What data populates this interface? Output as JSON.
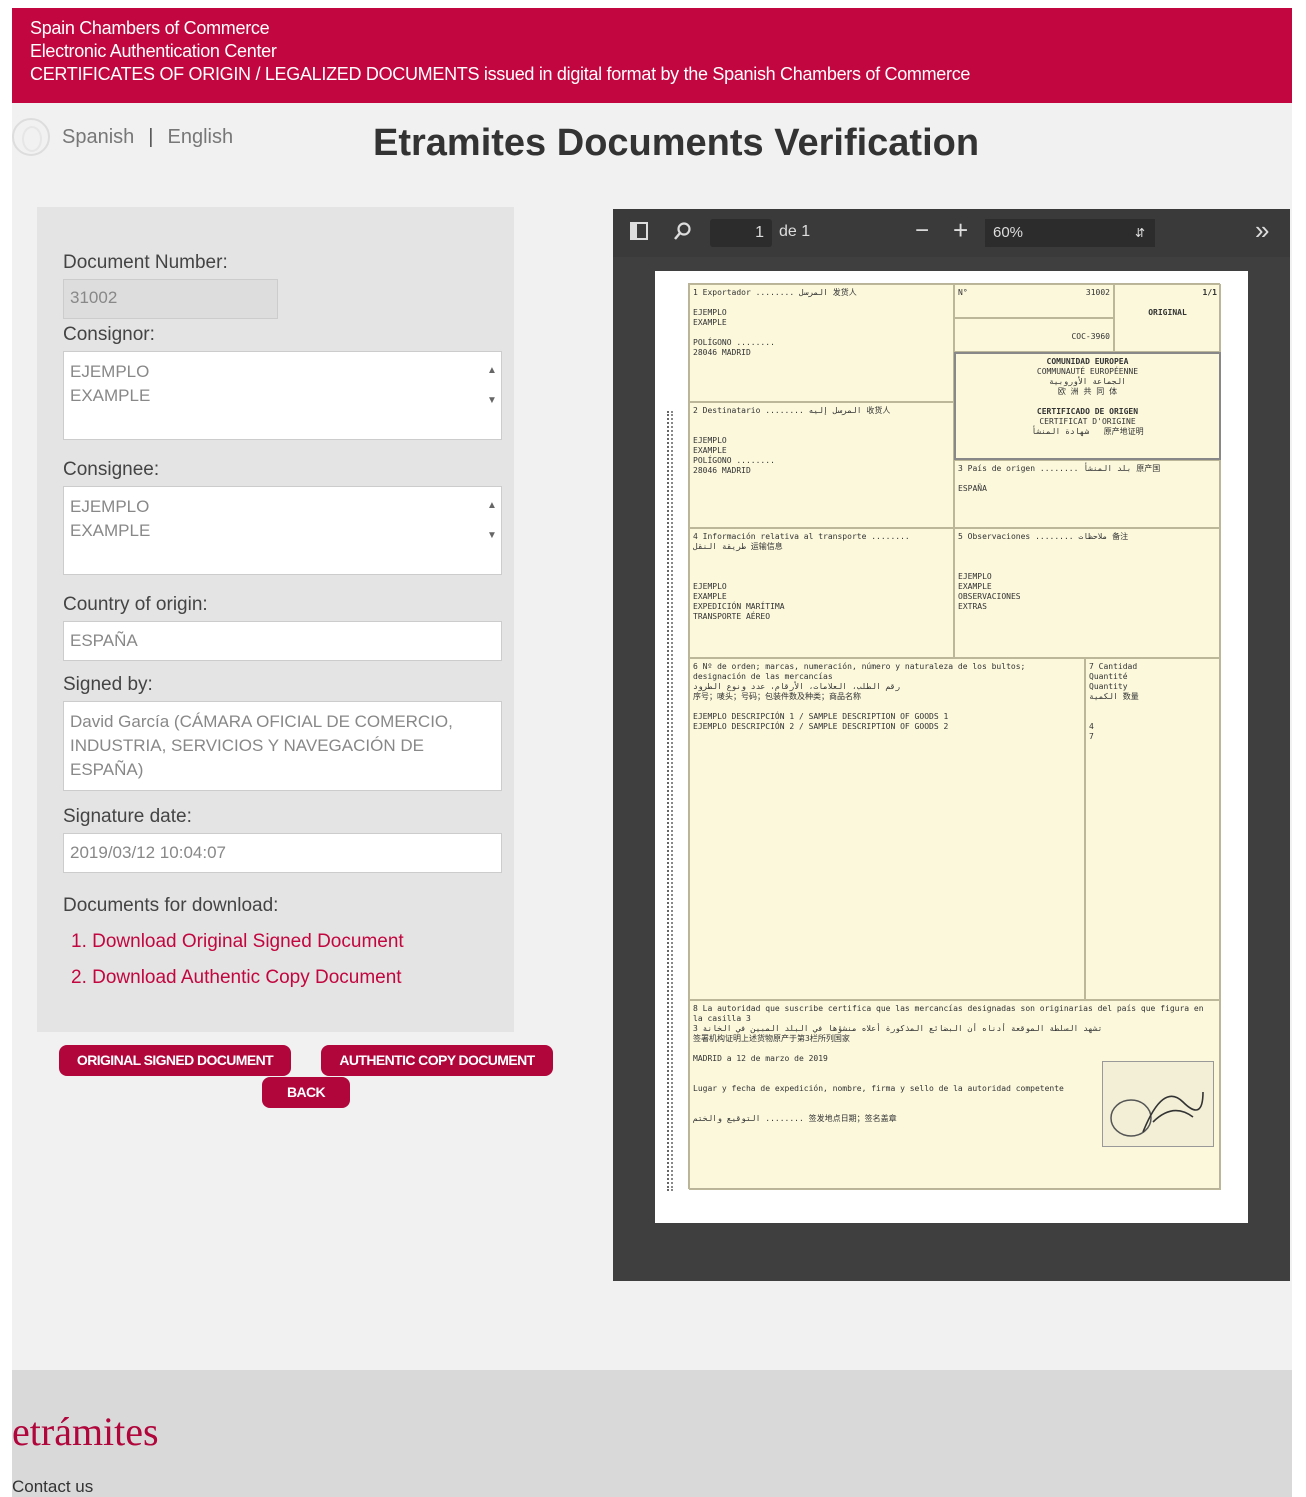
{
  "banner": {
    "line1": "Spain Chambers of Commerce",
    "line2": "Electronic Authentication Center",
    "line3": "CERTIFICATES OF ORIGIN / LEGALIZED DOCUMENTS issued in digital format by the Spanish Chambers of Commerce"
  },
  "lang": {
    "spanish": "Spanish",
    "sep": "|",
    "english": "English"
  },
  "page_title": "Etramites Documents Verification",
  "form": {
    "doc_number_label": "Document Number:",
    "doc_number_value": "31002",
    "consignor_label": "Consignor:",
    "consignor_value": "EJEMPLO\nEXAMPLE",
    "consignee_label": "Consignee:",
    "consignee_value": "EJEMPLO\nEXAMPLE",
    "country_label": "Country of origin:",
    "country_value": "ESPAÑA",
    "signed_label": "Signed by:",
    "signed_value": "David García (CÁMARA OFICIAL DE COMERCIO, INDUSTRIA, SERVICIOS Y NAVEGACIÓN DE ESPAÑA)",
    "sigdate_label": "Signature date:",
    "sigdate_value": "2019/03/12 10:04:07",
    "downloads_label": "Documents for download:",
    "download1": "1. Download Original Signed Document",
    "download2": "2. Download Authentic Copy Document"
  },
  "buttons": {
    "original": "ORIGINAL SIGNED DOCUMENT",
    "authentic": "AUTHENTIC COPY DOCUMENT",
    "back": "BACK"
  },
  "viewer": {
    "page_num": "1",
    "page_of": "de 1",
    "zoom": "60%",
    "zoom_minus": "−",
    "zoom_plus": "+",
    "more": "»"
  },
  "certificate": {
    "number": "31002",
    "original": "ORIGINAL",
    "page": "1/1",
    "code": "COC-3960",
    "community": "COMUNIDAD EUROPEA",
    "cert_title": "CERTIFICADO DE ORIGEN",
    "country_cell": "ESPAÑA",
    "place_date": "MADRID a 12 de marzo de 2019",
    "item1": "EJEMPLO DESCRIPCIÓN 1 / SAMPLE DESCRIPTION OF GOODS 1",
    "item2": "EJEMPLO DESCRIPCIÓN 2 / SAMPLE DESCRIPTION OF GOODS 2",
    "qty1": "4",
    "qty2": "7"
  },
  "footer": {
    "brand": "etrámites",
    "contact": "Contact us"
  },
  "colors": {
    "brand": "#c2063f",
    "button": "#b0063c",
    "viewer_bg": "#3f3f3f"
  }
}
